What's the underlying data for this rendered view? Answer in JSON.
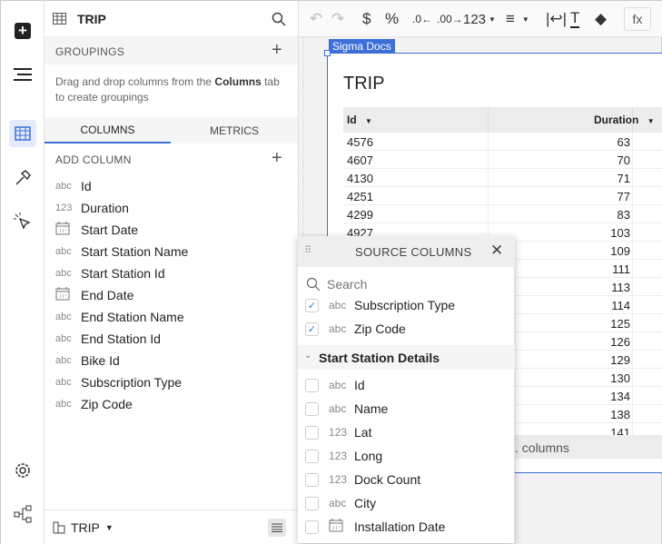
{
  "rail": {
    "icons": [
      "plus-icon",
      "menu-icon",
      "table-icon",
      "hammer-icon",
      "pointer-icon",
      "gear-icon",
      "lineage-icon"
    ]
  },
  "panel": {
    "title": "TRIP",
    "groupings_label": "GROUPINGS",
    "groupings_desc_pre": "Drag and drop columns from the ",
    "groupings_desc_bold": "Columns",
    "groupings_desc_post": " tab to create groupings",
    "tabs": [
      {
        "label": "COLUMNS",
        "active": true
      },
      {
        "label": "METRICS",
        "active": false
      }
    ],
    "add_column": "ADD COLUMN",
    "columns": [
      {
        "type": "abc",
        "name": "Id"
      },
      {
        "type": "123",
        "name": "Duration"
      },
      {
        "type": "date",
        "name": "Start Date"
      },
      {
        "type": "abc",
        "name": "Start Station Name"
      },
      {
        "type": "abc",
        "name": "Start Station Id"
      },
      {
        "type": "date",
        "name": "End Date"
      },
      {
        "type": "abc",
        "name": "End Station Name"
      },
      {
        "type": "abc",
        "name": "End Station Id"
      },
      {
        "type": "abc",
        "name": "Bike Id"
      },
      {
        "type": "abc",
        "name": "Subscription Type"
      },
      {
        "type": "abc",
        "name": "Zip Code"
      }
    ],
    "footer_source": "TRIP"
  },
  "toolbar": {
    "format_123": "123",
    "fx": "fx",
    "currency": "$",
    "percent": "%"
  },
  "page": {
    "tag": "Sigma Docs",
    "title": "TRIP",
    "headers": [
      "Id",
      "Duration"
    ],
    "rows": [
      [
        "4576",
        "63"
      ],
      [
        "4607",
        "70"
      ],
      [
        "4130",
        "71"
      ],
      [
        "4251",
        "77"
      ],
      [
        "4299",
        "83"
      ],
      [
        "4927",
        "103"
      ],
      [
        "",
        "109"
      ],
      [
        "",
        "111"
      ],
      [
        "",
        "113"
      ],
      [
        "",
        "114"
      ],
      [
        "",
        "125"
      ],
      [
        "",
        "126"
      ],
      [
        "",
        "129"
      ],
      [
        "",
        "130"
      ],
      [
        "",
        "134"
      ],
      [
        "",
        "138"
      ],
      [
        "",
        "141"
      ]
    ],
    "footer": ". columns"
  },
  "popup": {
    "title": "SOURCE COLUMNS",
    "search_placeholder": "Search",
    "checked": [
      {
        "type": "abc",
        "name": "Subscription Type"
      },
      {
        "type": "abc",
        "name": "Zip Code"
      }
    ],
    "group": "Start Station Details",
    "items": [
      {
        "type": "abc",
        "name": "Id"
      },
      {
        "type": "abc",
        "name": "Name"
      },
      {
        "type": "123",
        "name": "Lat"
      },
      {
        "type": "123",
        "name": "Long"
      },
      {
        "type": "123",
        "name": "Dock Count"
      },
      {
        "type": "abc",
        "name": "City"
      },
      {
        "type": "date",
        "name": "Installation Date"
      }
    ]
  },
  "colors": {
    "accent": "#3d6fd9"
  }
}
